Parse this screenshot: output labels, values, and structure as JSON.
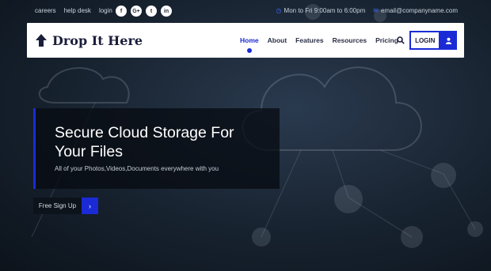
{
  "topbar": {
    "links": [
      "careers",
      "help desk",
      "login"
    ],
    "socials": [
      {
        "icon": "facebook-icon",
        "glyph": "f"
      },
      {
        "icon": "google-plus-icon",
        "glyph": "G+"
      },
      {
        "icon": "twitter-icon",
        "glyph": "t"
      },
      {
        "icon": "linkedin-icon",
        "glyph": "in"
      }
    ],
    "hours": "Mon to Fri 9:00am to 6:00pm",
    "email": "email@companyname.com"
  },
  "navbar": {
    "brand": "Drop It Here",
    "menu": [
      "Home",
      "About",
      "Features",
      "Resources",
      "Pricing"
    ],
    "active_index": 0,
    "login_label": "LOGIN"
  },
  "hero": {
    "title": "Secure Cloud Storage For Your Files",
    "subtitle": "All of your Photos,Videos,Documents everywhere with you"
  },
  "cta": {
    "label": "Free Sign Up",
    "arrow": "›"
  },
  "colors": {
    "accent": "#1a2bd6",
    "dark": "#0d131b"
  }
}
